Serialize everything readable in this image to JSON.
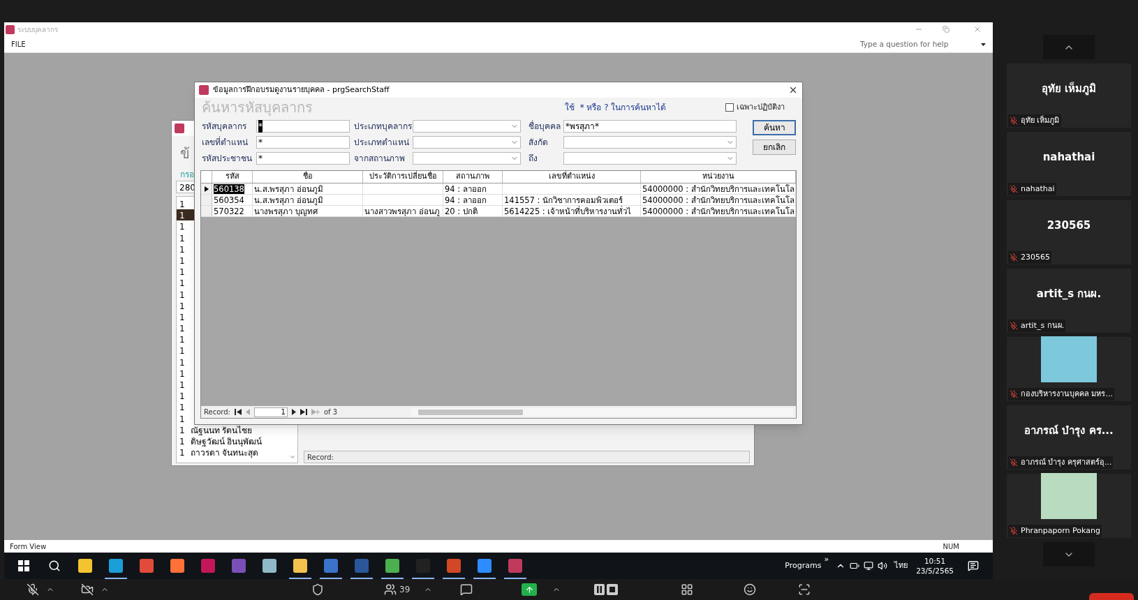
{
  "access_window": {
    "title": "ระบบบุคลากร",
    "menu": [
      "FILE"
    ],
    "help_placeholder": "Type a question for help",
    "status_left": "Form View",
    "status_right": "NUM"
  },
  "background_form": {
    "heading": "ข้",
    "label": "กรอ",
    "field_value": "280",
    "list": [
      {
        "col": "1",
        "selected": false
      },
      {
        "col": "1",
        "selected": true
      },
      {
        "col": "1",
        "selected": false
      },
      {
        "col": "1",
        "selected": false
      },
      {
        "col": "1",
        "selected": false
      },
      {
        "col": "1",
        "selected": false
      },
      {
        "col": "1",
        "selected": false
      },
      {
        "col": "1",
        "selected": false
      },
      {
        "col": "1",
        "selected": false
      },
      {
        "col": "1",
        "selected": false
      },
      {
        "col": "1",
        "selected": false
      },
      {
        "col": "1",
        "selected": false
      },
      {
        "col": "1",
        "selected": false
      },
      {
        "col": "1",
        "selected": false
      },
      {
        "col": "1",
        "selected": false
      },
      {
        "col": "1",
        "selected": false
      },
      {
        "col": "1",
        "selected": false
      },
      {
        "col": "1",
        "selected": false
      },
      {
        "col": "1",
        "selected": false
      },
      {
        "col": "1",
        "selected": false
      },
      {
        "col": "1",
        "name": "ณัฐนนท รัตนไชย",
        "selected": false
      },
      {
        "col": "1",
        "name": "ดิษฐวัฒน์ อินนุพัฒน์",
        "selected": false
      },
      {
        "col": "1",
        "name": "ถาวรดา จันทนะสุด",
        "selected": false
      }
    ],
    "record_label": "Record:"
  },
  "dialog": {
    "title": "ข้อมูลการฝึกอบรมดูงานรายบุคคล - prgSearchStaff",
    "heading": "ค้นหารหัสบุคลากร",
    "hint": "ใช้  * หรือ ? ในการค้นหาได้",
    "active_only": {
      "label": "เฉพาะปฏิบัติงา",
      "checked": false
    },
    "fields": [
      {
        "label": "รหัสบุคลากร",
        "kind": "text",
        "value": "*",
        "focused": true
      },
      {
        "label": "ประเภทบุคลากร",
        "kind": "combo",
        "focused": false
      },
      {
        "label": "ชื่อบุคคล",
        "kind": "text",
        "value": "*พรสุภา*",
        "focused": false
      },
      {
        "label": "เลขที่ตำแหน่",
        "kind": "text",
        "value": "*",
        "focused": false
      },
      {
        "label": "ประเภทตำแหน่",
        "kind": "combo",
        "focused": false
      },
      {
        "label": "สังกัด",
        "kind": "combo",
        "focused": false
      },
      {
        "label": "รหัสประชาชน",
        "kind": "text",
        "value": "*",
        "focused": false
      },
      {
        "label": "จากสถานภาพ",
        "kind": "combo",
        "focused": false
      },
      {
        "label": "ถึง",
        "kind": "combo",
        "focused": false
      }
    ],
    "buttons": [
      {
        "label": "ค้นหา",
        "default": true
      },
      {
        "label": "ยกเลิก",
        "default": false
      }
    ],
    "table": {
      "columns": [
        "รหัส",
        "ชื่อ",
        "ประวัติการเปลี่ยนชื่อ",
        "สถานภาพ",
        "เลขที่ตำแหน่ง",
        "หน่วยงาน"
      ],
      "rows": [
        {
          "selected": true,
          "cells": [
            "560138",
            "น.ส.พรสุภา อ่อนภูมิ",
            null,
            "94 : ลาออก",
            null,
            "54000000 : สำนักวิทยบริการและเทคโนโล"
          ]
        },
        {
          "selected": false,
          "cells": [
            "560354",
            "น.ส.พรสุภา อ่อนภูมิ",
            null,
            "94 : ลาออก",
            "141557 : นักวิชาการคอมพิวเตอร์",
            "54000000 : สำนักวิทยบริการและเทคโนโล"
          ]
        },
        {
          "selected": false,
          "cells": [
            "570322",
            "นางพรสุภา บุญทศ",
            "นางสาวพรสุภา อ่อนภู",
            "20 : ปกติ",
            "5614225 : เจ้าหน้าที่บริหารงานทั่วไ",
            "54000000 : สำนักวิทยบริการและเทคโนโล"
          ]
        }
      ]
    },
    "record_nav": {
      "label": "Record:",
      "current": "1",
      "total": "of 3"
    }
  },
  "taskbar": {
    "apps": [
      {
        "kind": "start",
        "running": false
      },
      {
        "kind": "search",
        "running": false
      },
      {
        "kind": "sticky",
        "running": false
      },
      {
        "kind": "edge",
        "running": true
      },
      {
        "kind": "s",
        "running": false
      },
      {
        "kind": "firefox",
        "running": false
      },
      {
        "kind": "db",
        "running": false
      },
      {
        "kind": "vs",
        "running": false
      },
      {
        "kind": "notes",
        "running": false
      },
      {
        "kind": "explorer",
        "running": true
      },
      {
        "kind": "remote",
        "running": true
      },
      {
        "kind": "word",
        "running": true
      },
      {
        "kind": "chrome",
        "running": true
      },
      {
        "kind": "pdf",
        "running": true
      },
      {
        "kind": "powerpoint",
        "running": true
      },
      {
        "kind": "zoom",
        "running": true
      },
      {
        "kind": "access",
        "running": true
      }
    ],
    "programs": "Programs",
    "chevrons": "»",
    "language": "ไทย",
    "time": "10:51",
    "date": "23/5/2565"
  },
  "participants": [
    {
      "kind": "name",
      "display_name": "อุทัย เห็มภูมิ",
      "label": "อุทัย เห็มภูมิ"
    },
    {
      "kind": "name",
      "display_name": "nahathai",
      "label": "nahathai"
    },
    {
      "kind": "name",
      "display_name": "230565",
      "label": "230565"
    },
    {
      "kind": "name",
      "display_name": "artit_s กนผ.",
      "label": "artit_s กนผ."
    },
    {
      "kind": "logo",
      "label": "กองบริหารงานบุคคล มหร..."
    },
    {
      "kind": "name",
      "display_name": "อาภรณ์ บำรุง คร...",
      "label": "อาภรณ์ บำรุง ครุศาสตร์อุ..."
    },
    {
      "kind": "photo",
      "label": "Phranpaporn Pokang"
    }
  ],
  "meeting": {
    "participants_count": "39"
  }
}
